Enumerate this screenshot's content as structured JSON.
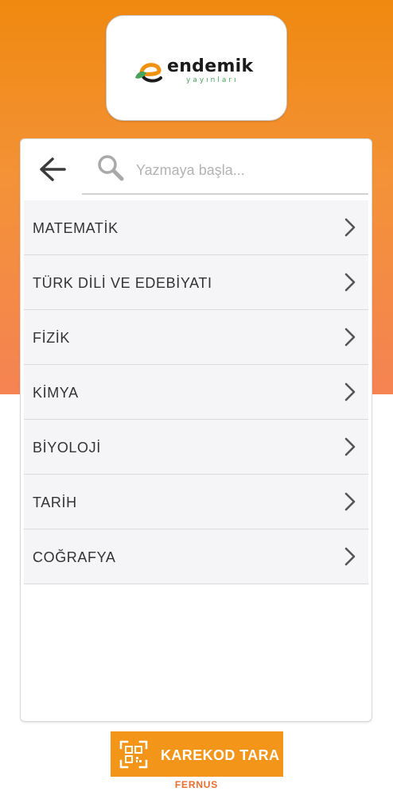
{
  "logo": {
    "word": "endemik",
    "sub": "yayınları",
    "colors": {
      "orange": "#f0920f",
      "green": "#4aa35a",
      "text": "#1b1b1b"
    }
  },
  "header": {
    "back_icon": "arrow-left-icon",
    "search_icon": "search-icon",
    "search_placeholder": "Yazmaya başla...",
    "search_value": ""
  },
  "subjects": [
    {
      "label": "MATEMATİK",
      "icon": "chevron-right-icon"
    },
    {
      "label": "TÜRK DİLİ VE EDEBİYATI",
      "icon": "chevron-right-icon"
    },
    {
      "label": "FİZİK",
      "icon": "chevron-right-icon"
    },
    {
      "label": "KİMYA",
      "icon": "chevron-right-icon"
    },
    {
      "label": "BİYOLOJİ",
      "icon": "chevron-right-icon"
    },
    {
      "label": "TARİH",
      "icon": "chevron-right-icon"
    },
    {
      "label": "COĞRAFYA",
      "icon": "chevron-right-icon"
    }
  ],
  "footer": {
    "qr_button_label": "KAREKOD TARA",
    "qr_icon": "qr-scan-icon",
    "brand": "FERNUS"
  },
  "theme": {
    "gradient_top": "#f0890f",
    "gradient_bottom": "#f58353",
    "button_orange": "#f39519",
    "brand_color": "#ec6d2d"
  }
}
